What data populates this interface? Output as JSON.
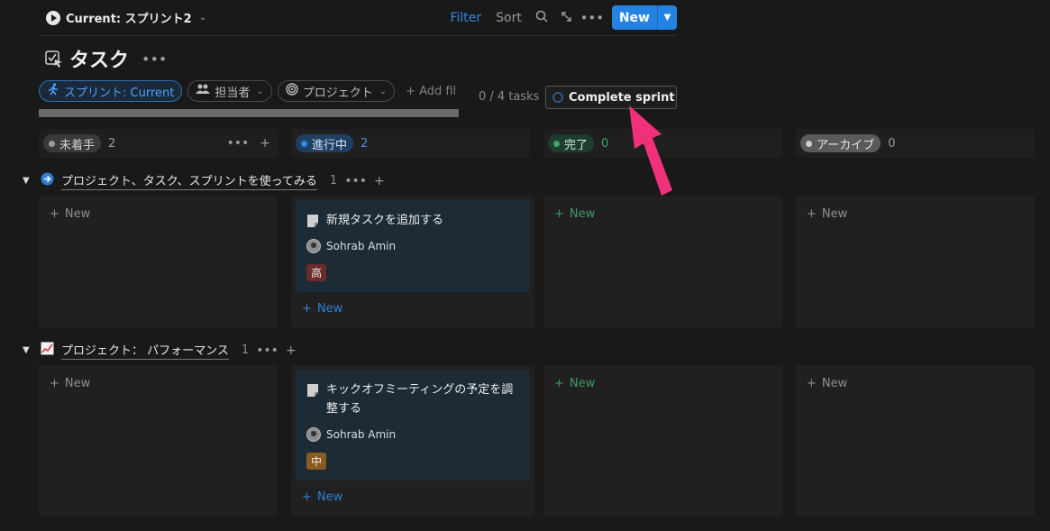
{
  "toolbar": {
    "view_name": "Current: スプリント2",
    "filter_label": "Filter",
    "sort_label": "Sort",
    "new_label": "New"
  },
  "page": {
    "title": "タスク"
  },
  "filters": {
    "sprint_label": "スプリント: Current",
    "assignee_label": "担当者",
    "project_label": "プロジェクト",
    "add_filter_label": "Add fil"
  },
  "sprint": {
    "tasks_count": "0 / 4 tasks",
    "complete_label": "Complete sprint",
    "progress": 0
  },
  "columns": [
    {
      "label": "未着手",
      "count": "2",
      "badge_bg": "#3a3a3a",
      "text_color": "#d4d4d4",
      "dot_color": "#9b9b9b",
      "count_color": "#9b9b9b"
    },
    {
      "label": "進行中",
      "count": "2",
      "badge_bg": "#1f3f63",
      "text_color": "#d6e6ff",
      "dot_color": "#2f8ae0",
      "count_color": "#4a8ad6"
    },
    {
      "label": "完了",
      "count": "0",
      "badge_bg": "#1f3d2c",
      "text_color": "#d2ecd9",
      "dot_color": "#3fa46a",
      "count_color": "#3fa46a"
    },
    {
      "label": "アーカイブ",
      "count": "0",
      "badge_bg": "#5a5a5a",
      "text_color": "#e8e8e8",
      "dot_color": "#cfcfcf",
      "count_color": "#9b9b9b"
    }
  ],
  "new_cell_label": "New",
  "groups": [
    {
      "title": "プロジェクト、タスク、スプリントを使ってみる",
      "count": "1",
      "icon": "arrow-circle-icon",
      "card": {
        "title": "新規タスクを追加する",
        "assignee": "Sohrab Amin",
        "priority": "高",
        "priority_color": "#6b2c2a"
      }
    },
    {
      "title": "プロジェクト： パフォーマンス",
      "count": "1",
      "icon": "chart-up-icon",
      "card": {
        "title": "キックオフミーティングの予定を調整する",
        "assignee": "Sohrab Amin",
        "priority": "中",
        "priority_color": "#8a5a1e"
      }
    }
  ],
  "colors": {
    "accent": "#2383e2",
    "annotation_arrow": "#f0317a"
  }
}
